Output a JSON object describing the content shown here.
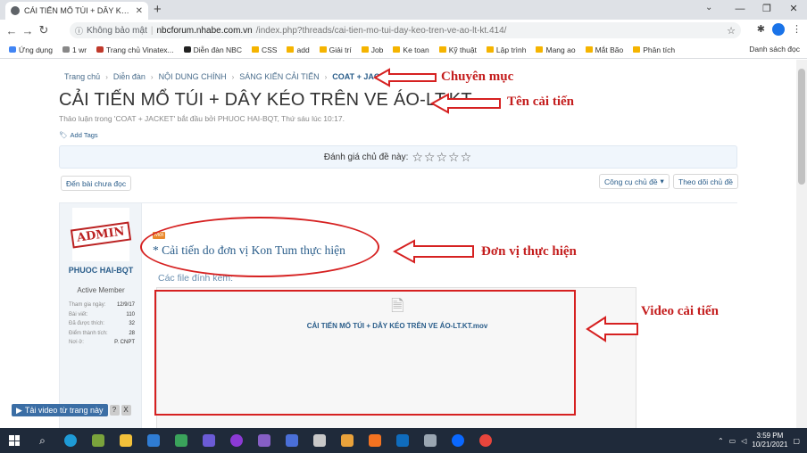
{
  "browser": {
    "tab_title": "CẢI TIẾN MỔ TÚI + DÂY KÉO TRÊN VE ÁO-LT.KT | ...",
    "new_tab": "+",
    "security_label": "Không bảo mật",
    "url_host": "nbcforum.nhabe.com.vn",
    "url_path": "/index.php?threads/cai-tien-mo-tui-day-keo-tren-ve-ao-lt-kt.414/",
    "bookmarks": [
      "Ứng dụng",
      "1 wr",
      "Trang chủ Vinatex...",
      "Diễn đàn NBC",
      "CSS",
      "add",
      "Giải trí",
      "Job",
      "Ke toan",
      "Kỹ thuật",
      "Lập trình",
      "Mang ao",
      "Mắt Bão",
      "Phân tích"
    ],
    "bookmarks_right": "Danh sách đọc"
  },
  "breadcrumb": [
    "Trang chủ",
    "Diễn đàn",
    "NỘI DUNG CHÍNH",
    "SÁNG KIẾN CẢI TIẾN",
    "COAT + JACKET"
  ],
  "thread": {
    "title": "CẢI TIẾN MỔ TÚI + DÂY KÉO TRÊN VE ÁO-LT.KT",
    "meta": "Thảo luận trong 'COAT + JACKET' bắt đầu bởi PHUOC HAI-BQT, Thứ sáu lúc 10:17.",
    "add_tags": "Add Tags",
    "rating_label": "Đánh giá chủ đề này:",
    "stars": "☆☆☆☆☆",
    "unread_button": "Đến bài chưa đọc",
    "tools_button": "Công cụ chủ đề",
    "watch_button": "Theo dõi chủ đề"
  },
  "user": {
    "stamp_text": "ADMIN",
    "name": "PHUOC HAI-BQT",
    "title": "Active Member",
    "stats": [
      {
        "label": "Tham gia ngày:",
        "value": "12/9/17"
      },
      {
        "label": "Bài viết:",
        "value": "110"
      },
      {
        "label": "Đã được thích:",
        "value": "32"
      },
      {
        "label": "Điểm thành tích:",
        "value": "28"
      },
      {
        "label": "Nơi ở:",
        "value": "P. CNPT"
      }
    ]
  },
  "post": {
    "new_badge": "Mới",
    "text": "* Cải tiến do đơn vị Kon Tum thực hiện",
    "attach_label": "Các file đính kèm:",
    "file_name": "CẢI TIẾN MỔ TÚI + DÂY KÉO TRÊN VE ÁO-LT.KT.mov"
  },
  "annotations": {
    "category": "Chuyên mục",
    "name": "Tên cải tiến",
    "unit": "Đơn vị thực hiện",
    "video": "Video cải tiến",
    "color": "#d62121"
  },
  "download_bar": {
    "label": "Tải video từ trang này",
    "help": "?",
    "close": "X"
  },
  "taskbar": {
    "time": "3:59 PM",
    "date": "10/21/2021"
  }
}
